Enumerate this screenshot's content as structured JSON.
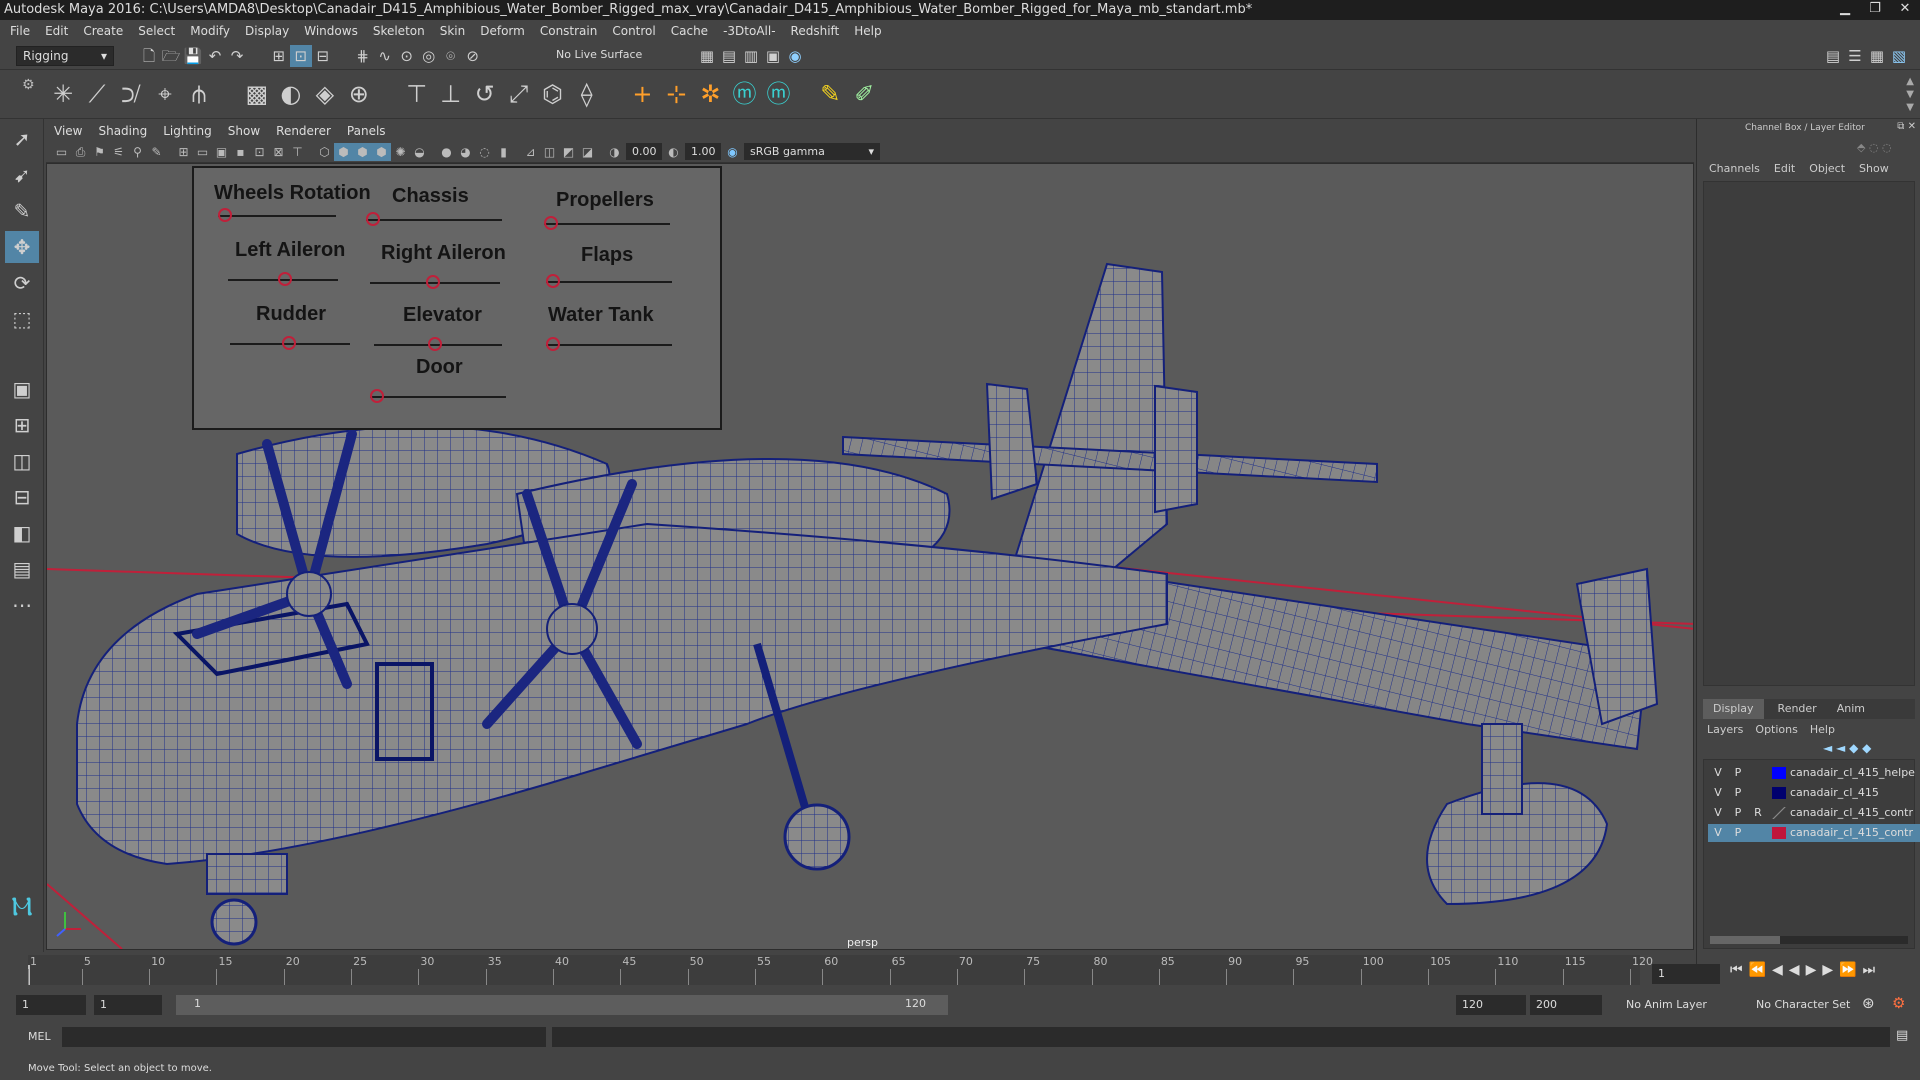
{
  "window": {
    "title": "Autodesk Maya 2016: C:\\Users\\AMDA8\\Desktop\\Canadair_D415_Amphibious_Water_Bomber_Rigged_max_vray\\Canadair_D415_Amphibious_Water_Bomber_Rigged_for_Maya_mb_standart.mb*",
    "minimize": "▁",
    "maximize": "❐",
    "close": "✕"
  },
  "menu": [
    "File",
    "Edit",
    "Create",
    "Select",
    "Modify",
    "Display",
    "Windows",
    "Skeleton",
    "Skin",
    "Deform",
    "Constrain",
    "Control",
    "Cache",
    "-3DtoAll-",
    "Redshift",
    "Help"
  ],
  "status": {
    "mode": "Rigging",
    "live_surface": "No Live Surface"
  },
  "panel": {
    "menu": [
      "View",
      "Shading",
      "Lighting",
      "Show",
      "Renderer",
      "Panels"
    ],
    "exposure": "0.00",
    "gamma": "1.00",
    "colorspace": "sRGB gamma",
    "camera": "persp"
  },
  "control_panel": {
    "labels": [
      "Wheels Rotation",
      "Chassis",
      "Propellers",
      "Left Aileron",
      "Right Aileron",
      "Flaps",
      "Rudder",
      "Elevator",
      "Water Tank",
      "Door"
    ]
  },
  "channel_box": {
    "title": "Channel Box / Layer Editor",
    "menu": [
      "Channels",
      "Edit",
      "Object",
      "Show"
    ],
    "tabs": [
      "Display",
      "Render",
      "Anim"
    ],
    "layer_menu": [
      "Layers",
      "Options",
      "Help"
    ],
    "layers": [
      {
        "v": "V",
        "p": "P",
        "r": "",
        "name": "canadair_cl_415_helpe",
        "color": "#0000ff"
      },
      {
        "v": "V",
        "p": "P",
        "r": "",
        "name": "canadair_cl_415",
        "color": "#00006e"
      },
      {
        "v": "V",
        "p": "P",
        "r": "R",
        "name": "canadair_cl_415_contr",
        "color": ""
      },
      {
        "v": "V",
        "p": "P",
        "r": "",
        "name": "canadair_cl_415_contr",
        "color": "#c0153b"
      }
    ]
  },
  "timeline": {
    "ticks": [
      "1",
      "5",
      "10",
      "15",
      "20",
      "25",
      "30",
      "35",
      "40",
      "45",
      "50",
      "55",
      "60",
      "65",
      "70",
      "75",
      "80",
      "85",
      "90",
      "95",
      "100",
      "105",
      "110",
      "115",
      "120"
    ],
    "current_frame": "1"
  },
  "range": {
    "start": "1",
    "playback_start": "1",
    "slider_start": "1",
    "slider_end": "120",
    "playback_end": "120",
    "end": "200",
    "anim_layer": "No Anim Layer",
    "character_set": "No Character Set"
  },
  "mel": {
    "label": "MEL"
  },
  "help": {
    "text": "Move Tool: Select an object to move."
  }
}
